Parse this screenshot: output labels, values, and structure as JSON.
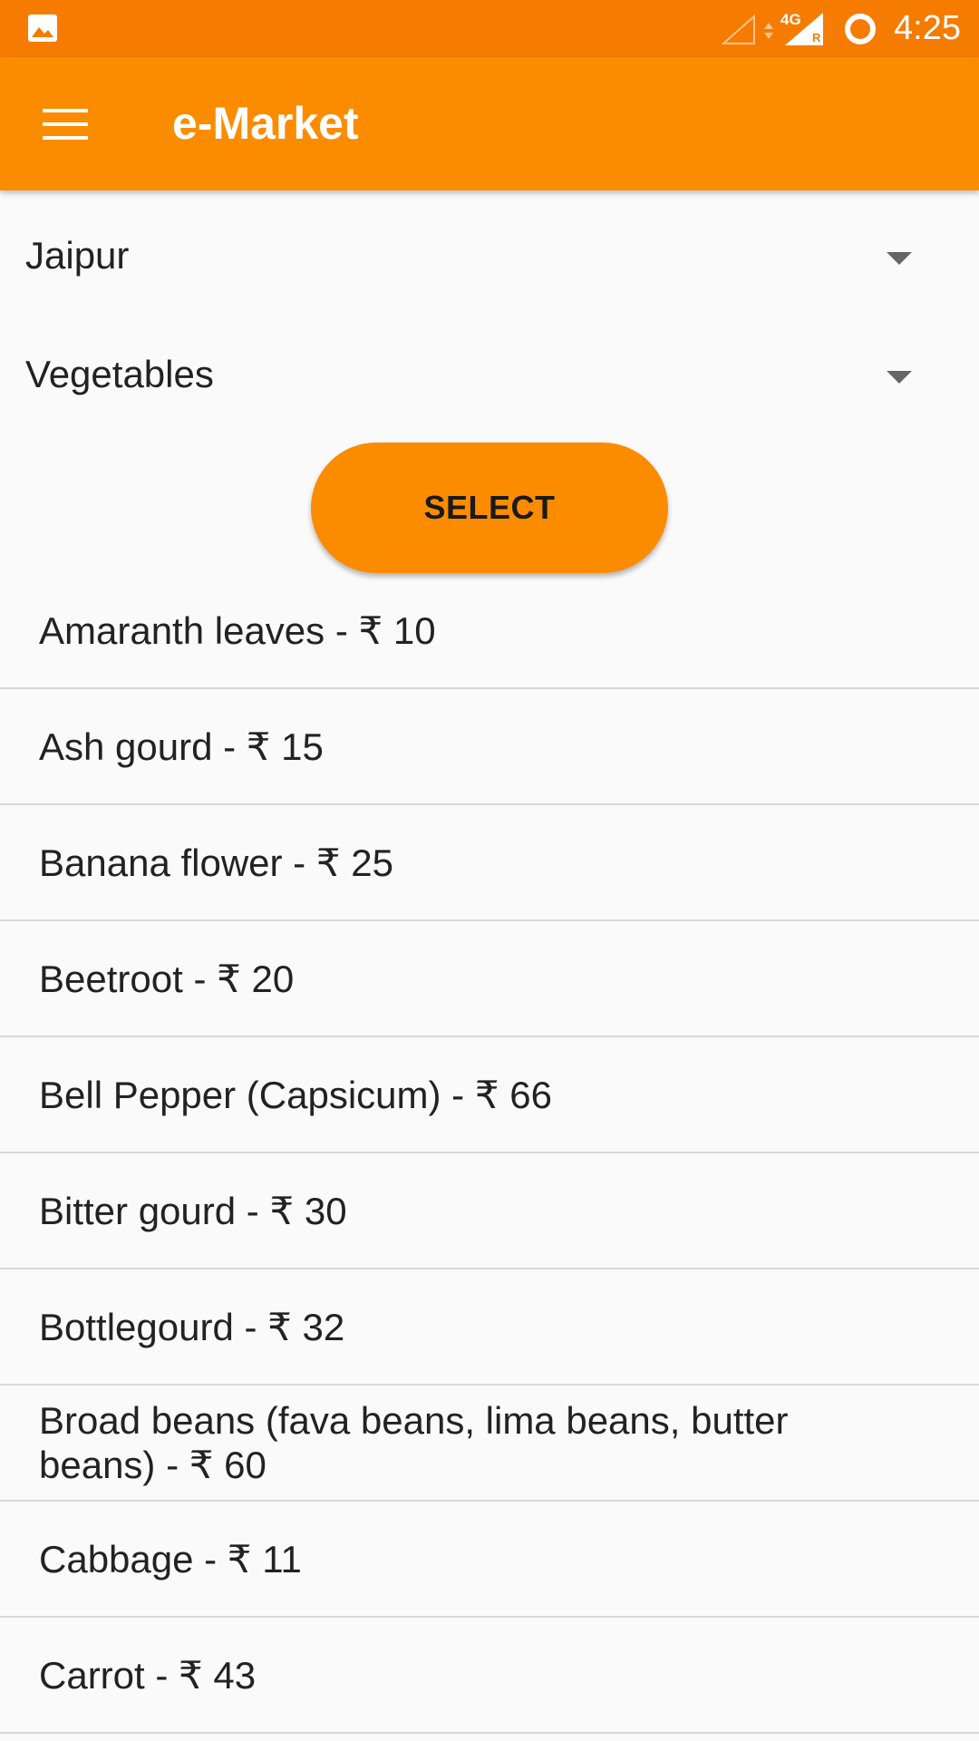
{
  "status_bar": {
    "time": "4:25",
    "network": "4G",
    "roaming": "R",
    "icons": [
      "gallery-icon",
      "signal-empty-icon",
      "data-arrows-icon",
      "signal-full-icon",
      "battery-ring-icon"
    ]
  },
  "app_bar": {
    "title": "e-Market",
    "menu_icon": "hamburger-menu-icon"
  },
  "filters": {
    "city": {
      "selected": "Jaipur"
    },
    "category": {
      "selected": "Vegetables"
    }
  },
  "select_button": {
    "label": "SELECT"
  },
  "products": [
    {
      "label": "Amaranth leaves - ₹ 10"
    },
    {
      "label": "Ash gourd - ₹ 15"
    },
    {
      "label": "Banana flower - ₹ 25"
    },
    {
      "label": "Beetroot - ₹ 20"
    },
    {
      "label": "Bell Pepper (Capsicum) - ₹ 66"
    },
    {
      "label": "Bitter gourd - ₹ 30"
    },
    {
      "label": "Bottlegourd - ₹ 32"
    },
    {
      "label": "Broad beans (fava beans, lima beans, butter beans) - ₹ 60"
    },
    {
      "label": "Cabbage - ₹ 11"
    },
    {
      "label": "Carrot - ₹ 43"
    }
  ],
  "colors": {
    "status_bar": "#f57c00",
    "app_bar": "#fb8c00",
    "accent": "#fb8c00",
    "background": "#fafafa",
    "divider": "#d8d8d8"
  }
}
